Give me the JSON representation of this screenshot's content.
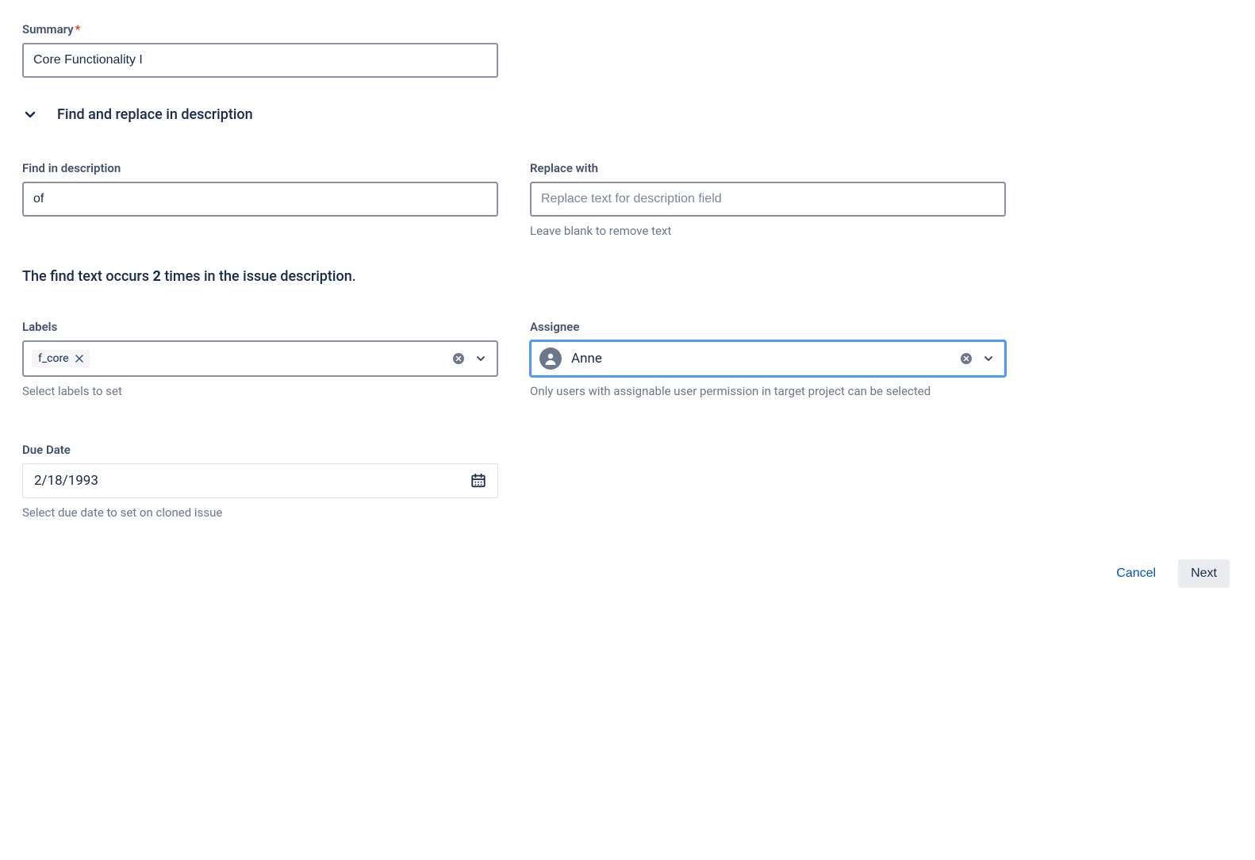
{
  "summary": {
    "label": "Summary",
    "value": "Core Functionality I"
  },
  "collapse": {
    "label": "Find and replace in description"
  },
  "find": {
    "label": "Find in description",
    "value": "of"
  },
  "replace": {
    "label": "Replace with",
    "placeholder": "Replace text for description field",
    "hint": "Leave blank to remove text"
  },
  "occurs": {
    "prefix": "The find text occurs ",
    "count": "2",
    "suffix": " times in the issue description."
  },
  "labels": {
    "label": "Labels",
    "chip": "f_core",
    "hint": "Select labels to set"
  },
  "assignee": {
    "label": "Assignee",
    "value": "Anne",
    "hint": "Only users with assignable user permission in target project can be selected"
  },
  "dueDate": {
    "label": "Due Date",
    "value": "2/18/1993",
    "hint": "Select due date to set on cloned issue"
  },
  "footer": {
    "cancel": "Cancel",
    "next": "Next"
  }
}
